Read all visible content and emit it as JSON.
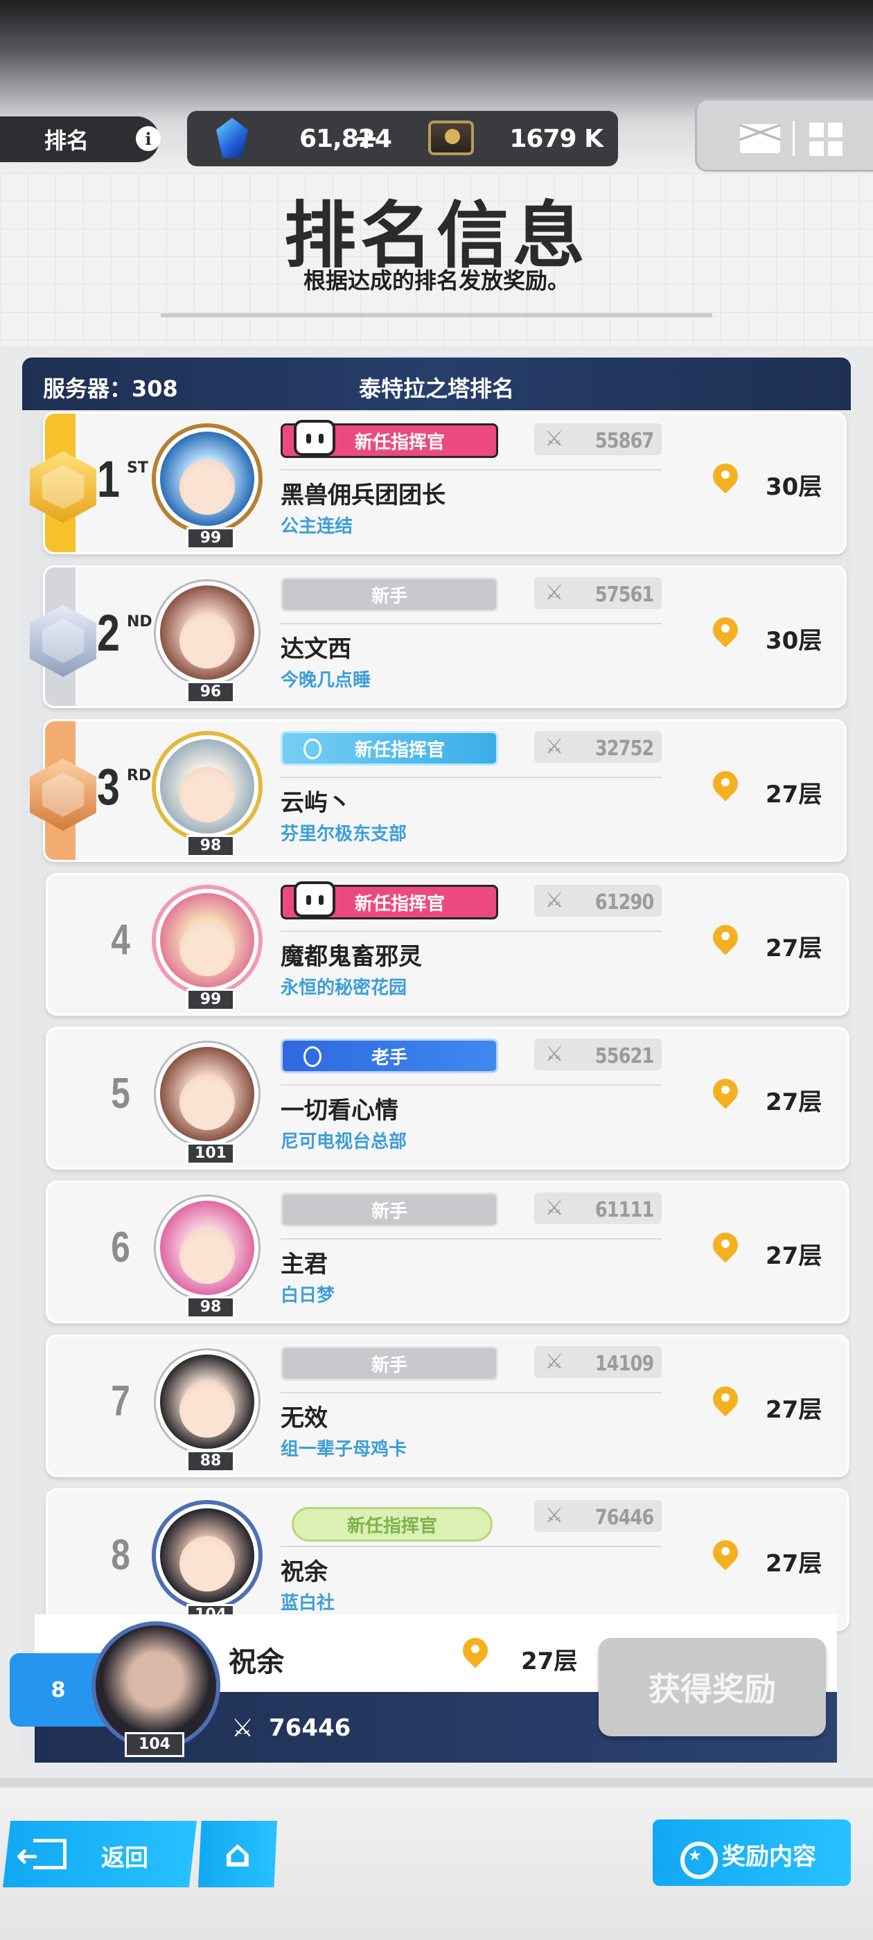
{
  "header": {
    "tab_label": "排名",
    "gems": "61,824",
    "plus": "+",
    "gold": "1679 K"
  },
  "title": {
    "main": "排名信息",
    "subtitle": "根据达成的排名发放奖励。"
  },
  "panel": {
    "server_label": "服务器：308",
    "title": "泰特拉之塔排名"
  },
  "rows": [
    {
      "rank": "1",
      "suffix": "ST",
      "level": "99",
      "badge": "新任指挥官",
      "badge_style": "pink",
      "power": "55867",
      "name": "黑兽佣兵团团长",
      "guild": "公主连结",
      "floor": "30层"
    },
    {
      "rank": "2",
      "suffix": "ND",
      "level": "96",
      "badge": "新手",
      "badge_style": "grey",
      "power": "57561",
      "name": "达文西",
      "guild": "今晚几点睡",
      "floor": "30层"
    },
    {
      "rank": "3",
      "suffix": "RD",
      "level": "98",
      "badge": "新任指挥官",
      "badge_style": "cyan",
      "power": "32752",
      "name": "云屿丶",
      "guild": "芬里尔极东支部",
      "floor": "27层"
    },
    {
      "rank": "4",
      "level": "99",
      "badge": "新任指挥官",
      "badge_style": "pink",
      "power": "61290",
      "name": "魔都鬼畜邪灵",
      "guild": "永恒的秘密花园",
      "floor": "27层"
    },
    {
      "rank": "5",
      "level": "101",
      "badge": "老手",
      "badge_style": "blue",
      "power": "55621",
      "name": "一切看心情",
      "guild": "尼可电视台总部",
      "floor": "27层"
    },
    {
      "rank": "6",
      "level": "98",
      "badge": "新手",
      "badge_style": "grey",
      "power": "61111",
      "name": "主君",
      "guild": "白日梦",
      "floor": "27层"
    },
    {
      "rank": "7",
      "level": "88",
      "badge": "新手",
      "badge_style": "grey",
      "power": "14109",
      "name": "无效",
      "guild": "组一辈子母鸡卡",
      "floor": "27层"
    },
    {
      "rank": "8",
      "level": "104",
      "badge": "新任指挥官",
      "badge_style": "green",
      "power": "76446",
      "name": "祝余",
      "guild": "蓝白社",
      "floor": "27层"
    }
  ],
  "me": {
    "rank": "8",
    "level": "104",
    "name": "祝余",
    "floor": "27层",
    "power": "76446",
    "claim_label": "获得奖励"
  },
  "nav": {
    "back_label": "返回",
    "rewards_label": "奖励内容"
  },
  "colors": {
    "accent_blue": "#1aa9f3",
    "header_navy": "#1e2f52",
    "guild_blue": "#3d9ed8",
    "pin_yellow": "#f5b01f"
  }
}
